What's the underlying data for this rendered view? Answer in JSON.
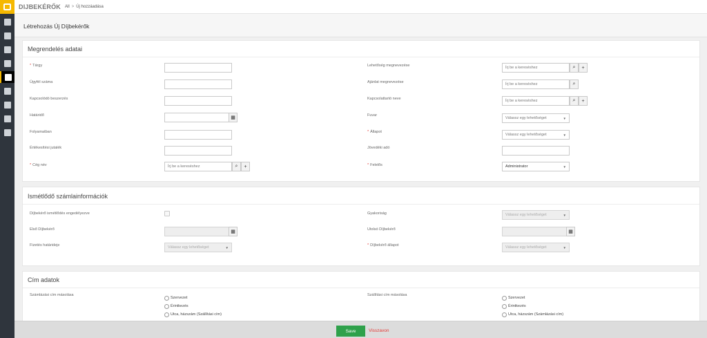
{
  "app": {
    "brand": "DIJBEKÉRŐK"
  },
  "breadcrumb": {
    "first": "All",
    "sep": ">",
    "second": "Új hozzáadása"
  },
  "page": {
    "title": "Létrehozás Új Díjbekérők"
  },
  "sidebar": {
    "icons": [
      "shield-icon",
      "car-icon",
      "contacts-icon",
      "list-icon",
      "invoice-icon",
      "calculator-icon",
      "team-icon",
      "user-icon",
      "building-icon"
    ],
    "active_index": 4
  },
  "order": {
    "title": "Megrendelés adatai",
    "left": [
      {
        "label": "Tárgy",
        "required": true
      },
      {
        "label": "Ügyfél száma",
        "required": false
      },
      {
        "label": "Kapcsolódó beszerzés",
        "required": false
      },
      {
        "label": "Határidő",
        "required": false
      },
      {
        "label": "Folyamatban",
        "required": false
      },
      {
        "label": "Értékesítési jutalék",
        "required": false
      },
      {
        "label": "Cég név",
        "required": true,
        "placeholder": "Írj be a kereséshez"
      }
    ],
    "right": [
      {
        "label": "Lehetőség megnevezése",
        "placeholder": "Írj be a kereséshez"
      },
      {
        "label": "Ajánlat megnevezése",
        "placeholder": "Írj be a kereséshez"
      },
      {
        "label": "Kapcsolattartó neve",
        "placeholder": "Írj be a kereséshez"
      },
      {
        "label": "Fuvar",
        "value": "Válassz egy lehetőséget"
      },
      {
        "label": "Állapot",
        "required": true,
        "value": "Válassz egy lehetőséget"
      },
      {
        "label": "Jövedéki adó"
      },
      {
        "label": "Felelős",
        "required": true,
        "value": "Administrator"
      }
    ]
  },
  "recurring": {
    "title": "Ismétlődő számlainformációk",
    "left": [
      {
        "label": "Díjbekérő ismétlődés engedélyezve"
      },
      {
        "label": "Első Díjbekérő"
      },
      {
        "label": "Fizetés határideje",
        "value": "Válassz egy lehetőséget"
      }
    ],
    "right": [
      {
        "label": "Gyakoriság",
        "value": "Válassz egy lehetőséget"
      },
      {
        "label": "Utolsó Díjbekérő"
      },
      {
        "label": "Díjbekérő állapot",
        "required": true,
        "value": "Válassz egy lehetőséget"
      }
    ]
  },
  "address": {
    "title": "Cím adatok",
    "left_label": "Számlázási cím másolása",
    "left_options": [
      "Szervezet",
      "Érintkezés",
      "Utca, házszám (Szállítási cím)"
    ],
    "right_label": "Szállítási cím másolása",
    "right_options": [
      "Szervezet",
      "Érintkezés",
      "Utca, házszám (Számlázási cím)"
    ]
  },
  "footer": {
    "save": "Save",
    "cancel": "Visszavon"
  },
  "colors": {
    "accent": "#f5b800",
    "save": "#2fa14b",
    "cancel": "#e53935",
    "sidebar": "#2f353d"
  }
}
